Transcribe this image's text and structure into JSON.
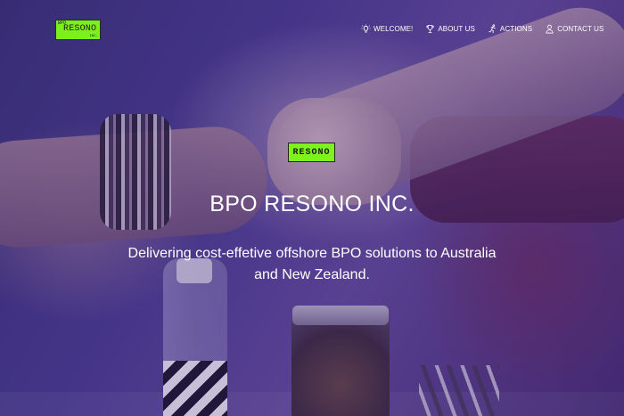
{
  "logo": {
    "small_text": "BPO",
    "main_text": "RESONO",
    "sub_text": "INC.",
    "color": "#7cf01a"
  },
  "nav": {
    "items": [
      {
        "label": "WELCOME!",
        "icon": "lightbulb-icon"
      },
      {
        "label": "ABOUT US",
        "icon": "trophy-icon"
      },
      {
        "label": "ACTIONS",
        "icon": "running-person-icon"
      },
      {
        "label": "CONTACT US",
        "icon": "person-icon"
      }
    ]
  },
  "hero": {
    "badge": "RESONO",
    "title": "BPO RESONO INC.",
    "subtitle": "Delivering cost-effetive offshore BPO solutions to Australia and New Zealand.",
    "accent_color": "#7ff21c",
    "overlay_color": "#2d1e6e"
  }
}
